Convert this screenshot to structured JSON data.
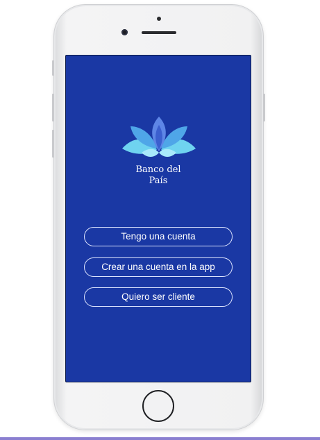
{
  "app": {
    "brand_line1": "Banco del",
    "brand_line2": "País"
  },
  "buttons": {
    "have_account": "Tengo una cuenta",
    "create_account": "Crear una cuenta en la app",
    "become_client": "Quiero ser cliente"
  },
  "colors": {
    "screen_background": "#1a38a4",
    "logo_light": "#6fd3f0",
    "logo_mid": "#4fa6e8",
    "logo_dark": "#3b74d9"
  },
  "icons": {
    "logo": "lotus-flower-icon",
    "home": "home-button-icon"
  }
}
